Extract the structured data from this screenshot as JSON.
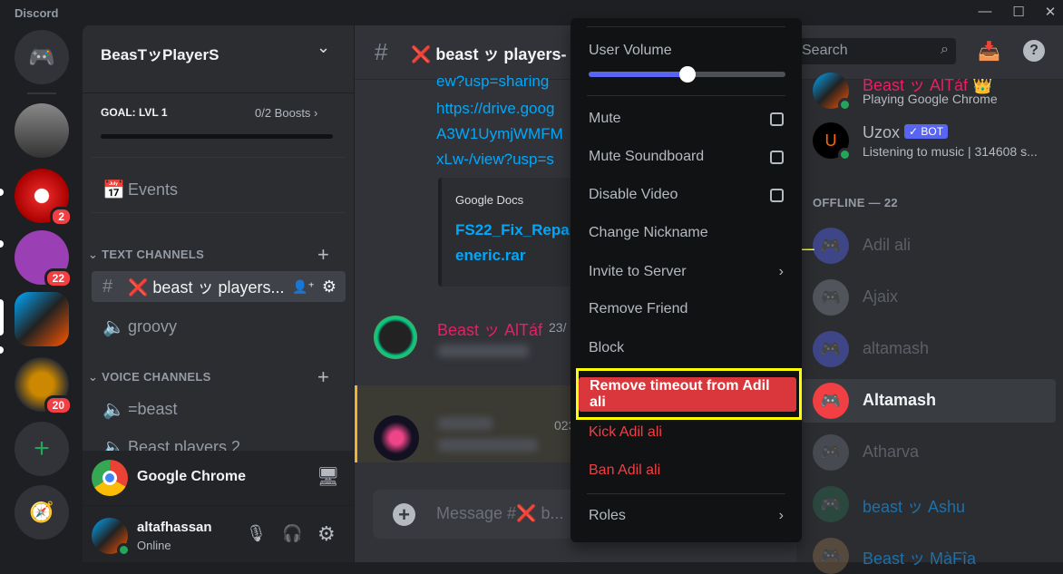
{
  "app": {
    "title": "Discord",
    "controls": [
      "minimize",
      "maximize",
      "close"
    ]
  },
  "servers": [
    {
      "name": "home",
      "icon": "discord-icon"
    },
    {
      "name": "pubg",
      "badge": ""
    },
    {
      "name": "pokeball",
      "badge": "2"
    },
    {
      "name": "purple",
      "badge": "22"
    },
    {
      "name": "beast",
      "badge": ""
    },
    {
      "name": "lion",
      "badge": "20"
    }
  ],
  "sidebar": {
    "server_name": "BeasTッPlayerS",
    "goal": "GOAL: LVL 1",
    "boosts": "0/2 Boosts",
    "boost_progress": 0,
    "events": "Events",
    "text_category": "TEXT CHANNELS",
    "voice_category": "VOICE CHANNELS",
    "channels": [
      {
        "name": "❌ beast ッ players...",
        "type": "text",
        "selected": true
      },
      {
        "name": "groovy",
        "type": "voice-locked"
      }
    ],
    "voice_channels": [
      {
        "name": "=beast"
      },
      {
        "name": "Beast players 2"
      }
    ],
    "activity": "Google Chrome",
    "user": {
      "name": "altafhassan",
      "status": "Online"
    }
  },
  "chat": {
    "channel_title": "❌ beast ッ players-",
    "links": [
      "ew?usp=sharing",
      "https://drive.goog",
      "A3W1UymjWMFM",
      "xLw-/view?usp=s"
    ],
    "embed_provider": "Google Docs",
    "embed_title": [
      "FS22_Fix_Repa",
      "eneric.rar"
    ],
    "author": "Beast ッ AlTáf",
    "timestamp": "23/",
    "timestamp2": "023",
    "message_placeholder": "Message #❌ b..."
  },
  "members": {
    "search_placeholder": "Search",
    "online": [
      {
        "name": "Beast ッ AlTáf",
        "status": "Playing Google Chrome",
        "color": "#e91e63",
        "crown": true
      },
      {
        "name": "Uzox",
        "bot_label": "✓ BOT",
        "status": "Listening to music | 314608 s..."
      }
    ],
    "offline_header": "OFFLINE — 22",
    "offline": [
      {
        "name": "Adil ali",
        "avatar_color": "#5865f2"
      },
      {
        "name": "Ajaix",
        "avatar_color": "#80848e"
      },
      {
        "name": "altamash",
        "avatar_color": "#5865f2"
      },
      {
        "name": "Altamash",
        "avatar_color": "#f23f43",
        "hovered": true
      },
      {
        "name": "Atharva",
        "avatar_color": "#6d6f78"
      },
      {
        "name": "beast ッ Ashu",
        "avatar_color": "#2d6a4f",
        "name_color": "#1f6fa8"
      },
      {
        "name": "Beast ッ MàFîa",
        "avatar_color": "#8a6d50",
        "name_color": "#1f6fa8"
      }
    ]
  },
  "context_menu": {
    "volume_label": "User Volume",
    "volume_percent": 50,
    "items": [
      {
        "label": "Mute",
        "checkbox": false
      },
      {
        "label": "Mute Soundboard",
        "checkbox": false
      },
      {
        "label": "Disable Video",
        "checkbox": false
      },
      {
        "label": "Change Nickname"
      },
      {
        "label": "Invite to Server",
        "submenu": true
      },
      {
        "label": "Remove Friend"
      },
      {
        "label": "Block"
      }
    ],
    "danger": [
      {
        "label": "Remove timeout from Adil ali",
        "highlighted": true
      },
      {
        "label": "Kick Adil ali"
      },
      {
        "label": "Ban Adil ali"
      }
    ],
    "roles": "Roles",
    "accent": "#5865f2",
    "danger_color": "#da373c",
    "highlight_outline": "#ffff00"
  }
}
